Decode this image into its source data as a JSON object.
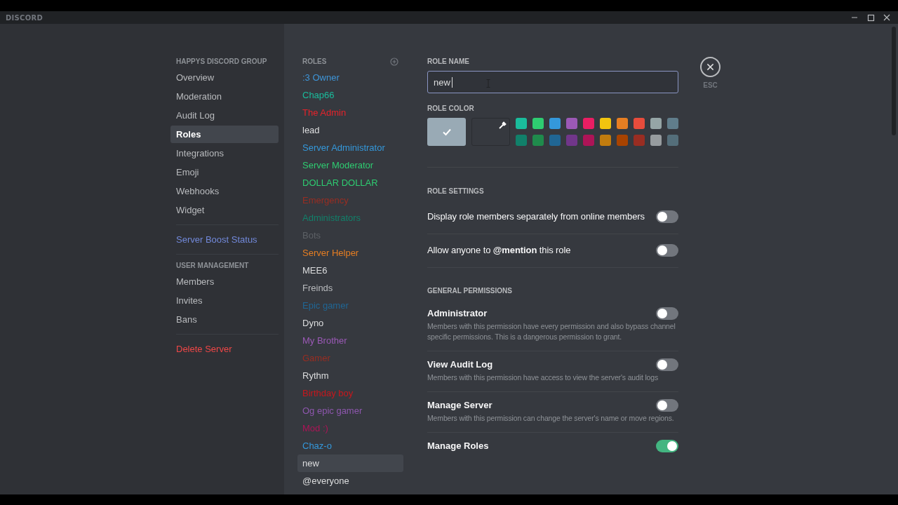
{
  "window": {
    "title": "DISCORD"
  },
  "sidebar": {
    "sections": [
      {
        "header": "HAPPYS DISCORD GROUP",
        "items": [
          {
            "label": "Overview",
            "kind": "normal",
            "selected": false
          },
          {
            "label": "Moderation",
            "kind": "normal",
            "selected": false
          },
          {
            "label": "Audit Log",
            "kind": "normal",
            "selected": false
          },
          {
            "label": "Roles",
            "kind": "normal",
            "selected": true
          },
          {
            "label": "Integrations",
            "kind": "normal",
            "selected": false
          },
          {
            "label": "Emoji",
            "kind": "normal",
            "selected": false
          },
          {
            "label": "Webhooks",
            "kind": "normal",
            "selected": false
          },
          {
            "label": "Widget",
            "kind": "normal",
            "selected": false
          }
        ]
      },
      {
        "items": [
          {
            "label": "Server Boost Status",
            "kind": "accent",
            "selected": false
          }
        ]
      },
      {
        "header": "USER MANAGEMENT",
        "items": [
          {
            "label": "Members",
            "kind": "normal",
            "selected": false
          },
          {
            "label": "Invites",
            "kind": "normal",
            "selected": false
          },
          {
            "label": "Bans",
            "kind": "normal",
            "selected": false
          }
        ]
      },
      {
        "items": [
          {
            "label": "Delete Server",
            "kind": "danger",
            "selected": false
          }
        ]
      }
    ]
  },
  "roles": {
    "header": "ROLES",
    "items": [
      {
        "name": ":3 Owner",
        "color": "#3e95d8",
        "selected": false
      },
      {
        "name": "Chap66",
        "color": "#1abc9c",
        "selected": false
      },
      {
        "name": "The Admin",
        "color": "#e8222a",
        "selected": false
      },
      {
        "name": "lead",
        "color": "#dcddde",
        "selected": false
      },
      {
        "name": "Server Administrator",
        "color": "#3498db",
        "selected": false
      },
      {
        "name": "Server Moderator",
        "color": "#2ecc71",
        "selected": false
      },
      {
        "name": "DOLLAR DOLLAR",
        "color": "#2ecc71",
        "selected": false
      },
      {
        "name": "Emergency",
        "color": "#992d22",
        "selected": false
      },
      {
        "name": "Administrators",
        "color": "#11806a",
        "selected": false
      },
      {
        "name": "Bots",
        "color": "#5d6166",
        "selected": false
      },
      {
        "name": "Server Helper",
        "color": "#e67e22",
        "selected": false
      },
      {
        "name": "MEE6",
        "color": "#dcddde",
        "selected": false
      },
      {
        "name": "Freinds",
        "color": "#b9bbbe",
        "selected": false
      },
      {
        "name": "Epic gamer",
        "color": "#206694",
        "selected": false
      },
      {
        "name": "Dyno",
        "color": "#dcddde",
        "selected": false
      },
      {
        "name": "My Brother",
        "color": "#9b59b6",
        "selected": false
      },
      {
        "name": "Gamer",
        "color": "#992d22",
        "selected": false
      },
      {
        "name": "Rythm",
        "color": "#dcddde",
        "selected": false
      },
      {
        "name": "Birthday boy",
        "color": "#c8171c",
        "selected": false
      },
      {
        "name": "Og epic gamer",
        "color": "#8e57ae",
        "selected": false
      },
      {
        "name": "Mod :)",
        "color": "#ad1457",
        "selected": false
      },
      {
        "name": "Chaz-o",
        "color": "#3498db",
        "selected": false
      },
      {
        "name": "new",
        "color": "#dcddde",
        "selected": true
      },
      {
        "name": "@everyone",
        "color": "#dcddde",
        "selected": false
      }
    ]
  },
  "editor": {
    "role_name": {
      "label": "ROLE NAME",
      "value": "new"
    },
    "role_color": {
      "label": "ROLE COLOR",
      "swatches": [
        {
          "kind": "default",
          "color": "#99aab5",
          "selected": true
        },
        {
          "kind": "custom",
          "selected": false
        },
        {
          "kind": "preset",
          "color": "#1abc9c",
          "selected": false
        },
        {
          "kind": "preset",
          "color": "#2ecc71",
          "selected": false
        },
        {
          "kind": "preset",
          "color": "#3498db",
          "selected": false
        },
        {
          "kind": "preset",
          "color": "#9b59b6",
          "selected": false
        },
        {
          "kind": "preset",
          "color": "#e91e63",
          "selected": false
        },
        {
          "kind": "preset",
          "color": "#f1c40f",
          "selected": false
        },
        {
          "kind": "preset",
          "color": "#e67e22",
          "selected": false
        },
        {
          "kind": "preset",
          "color": "#e74c3c",
          "selected": false
        },
        {
          "kind": "preset",
          "color": "#95a5a6",
          "selected": false
        },
        {
          "kind": "preset",
          "color": "#607d8b",
          "selected": false
        },
        {
          "kind": "preset",
          "color": "#11806a",
          "selected": false
        },
        {
          "kind": "preset",
          "color": "#1f8b4c",
          "selected": false
        },
        {
          "kind": "preset",
          "color": "#206694",
          "selected": false
        },
        {
          "kind": "preset",
          "color": "#71368a",
          "selected": false
        },
        {
          "kind": "preset",
          "color": "#ad1457",
          "selected": false
        },
        {
          "kind": "preset",
          "color": "#c27c0e",
          "selected": false
        },
        {
          "kind": "preset",
          "color": "#a84300",
          "selected": false
        },
        {
          "kind": "preset",
          "color": "#992d22",
          "selected": false
        },
        {
          "kind": "preset",
          "color": "#979c9f",
          "selected": false
        },
        {
          "kind": "preset",
          "color": "#546e7a",
          "selected": false
        }
      ]
    },
    "role_settings": {
      "header": "ROLE SETTINGS",
      "items": [
        {
          "label": "Display role members separately from online members",
          "on": false
        },
        {
          "label": "Allow anyone to **@mention** this role",
          "on": false
        }
      ]
    },
    "general_permissions": {
      "header": "GENERAL PERMISSIONS",
      "items": [
        {
          "title": "Administrator",
          "description": "Members with this permission have every permission and also bypass channel specific permissions. This is a dangerous permission to grant.",
          "on": false
        },
        {
          "title": "View Audit Log",
          "description": "Members with this permission have access to view the server's audit logs",
          "on": false
        },
        {
          "title": "Manage Server",
          "description": "Members with this permission can change the server's name or move regions.",
          "on": false
        },
        {
          "title": "Manage Roles",
          "on": true
        }
      ]
    }
  },
  "close": {
    "label": "ESC"
  }
}
